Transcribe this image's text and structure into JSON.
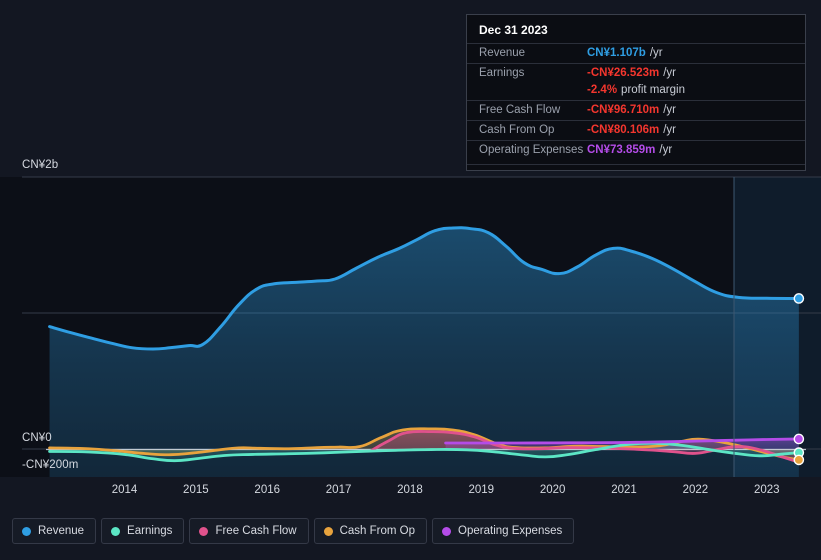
{
  "chart_data": {
    "type": "area",
    "title": "",
    "xlabel": "",
    "ylabel": "",
    "currency": "CN¥",
    "grid": true,
    "legend_position": "bottom",
    "y_ticks": [
      "CN¥2b",
      "CN¥0",
      "-CN¥200m"
    ],
    "ylim": [
      -200000000,
      2000000000
    ],
    "x_ticks": [
      "2014",
      "2015",
      "2016",
      "2017",
      "2018",
      "2019",
      "2020",
      "2021",
      "2022",
      "2023"
    ],
    "xlim": [
      "2013.4",
      "2024.1"
    ],
    "series": [
      {
        "name": "Revenue",
        "color": "#2f9ee3",
        "values": [
          {
            "x": 2013.45,
            "y": 900
          },
          {
            "x": 2013.75,
            "y": 855
          },
          {
            "x": 2014.0,
            "y": 820
          },
          {
            "x": 2014.3,
            "y": 780
          },
          {
            "x": 2014.6,
            "y": 745
          },
          {
            "x": 2014.9,
            "y": 735
          },
          {
            "x": 2015.15,
            "y": 745
          },
          {
            "x": 2015.4,
            "y": 760
          },
          {
            "x": 2015.6,
            "y": 770
          },
          {
            "x": 2015.85,
            "y": 900
          },
          {
            "x": 2016.1,
            "y": 1060
          },
          {
            "x": 2016.35,
            "y": 1175
          },
          {
            "x": 2016.6,
            "y": 1215
          },
          {
            "x": 2016.9,
            "y": 1225
          },
          {
            "x": 2017.2,
            "y": 1235
          },
          {
            "x": 2017.45,
            "y": 1250
          },
          {
            "x": 2017.75,
            "y": 1330
          },
          {
            "x": 2018.05,
            "y": 1410
          },
          {
            "x": 2018.35,
            "y": 1475
          },
          {
            "x": 2018.6,
            "y": 1540
          },
          {
            "x": 2018.85,
            "y": 1605
          },
          {
            "x": 2019.1,
            "y": 1625
          },
          {
            "x": 2019.35,
            "y": 1620
          },
          {
            "x": 2019.6,
            "y": 1590
          },
          {
            "x": 2019.85,
            "y": 1490
          },
          {
            "x": 2020.1,
            "y": 1370
          },
          {
            "x": 2020.35,
            "y": 1320
          },
          {
            "x": 2020.6,
            "y": 1290
          },
          {
            "x": 2020.85,
            "y": 1340
          },
          {
            "x": 2021.1,
            "y": 1425
          },
          {
            "x": 2021.35,
            "y": 1475
          },
          {
            "x": 2021.6,
            "y": 1455
          },
          {
            "x": 2021.9,
            "y": 1400
          },
          {
            "x": 2022.2,
            "y": 1320
          },
          {
            "x": 2022.5,
            "y": 1230
          },
          {
            "x": 2022.8,
            "y": 1150
          },
          {
            "x": 2023.1,
            "y": 1115
          },
          {
            "x": 2023.5,
            "y": 1108
          },
          {
            "x": 2023.95,
            "y": 1107
          }
        ]
      },
      {
        "name": "Earnings",
        "color": "#5ce6c5",
        "values": [
          {
            "x": 2013.45,
            "y": -18
          },
          {
            "x": 2014.0,
            "y": -22
          },
          {
            "x": 2014.5,
            "y": -40
          },
          {
            "x": 2014.9,
            "y": -72
          },
          {
            "x": 2015.2,
            "y": -86
          },
          {
            "x": 2015.5,
            "y": -72
          },
          {
            "x": 2015.9,
            "y": -48
          },
          {
            "x": 2016.3,
            "y": -40
          },
          {
            "x": 2016.8,
            "y": -35
          },
          {
            "x": 2017.3,
            "y": -28
          },
          {
            "x": 2017.8,
            "y": -18
          },
          {
            "x": 2018.3,
            "y": -10
          },
          {
            "x": 2018.8,
            "y": -4
          },
          {
            "x": 2019.3,
            "y": -6
          },
          {
            "x": 2019.7,
            "y": -22
          },
          {
            "x": 2020.1,
            "y": -45
          },
          {
            "x": 2020.4,
            "y": -58
          },
          {
            "x": 2020.7,
            "y": -42
          },
          {
            "x": 2021.1,
            "y": -5
          },
          {
            "x": 2021.5,
            "y": 30
          },
          {
            "x": 2021.8,
            "y": 42
          },
          {
            "x": 2022.1,
            "y": 38
          },
          {
            "x": 2022.4,
            "y": 20
          },
          {
            "x": 2022.7,
            "y": -5
          },
          {
            "x": 2023.0,
            "y": -28
          },
          {
            "x": 2023.4,
            "y": -50
          },
          {
            "x": 2023.7,
            "y": -38
          },
          {
            "x": 2023.95,
            "y": -26.523
          }
        ]
      },
      {
        "name": "Free Cash Flow",
        "color": "#e0528c",
        "values": [
          {
            "x": 2017.95,
            "y": -14
          },
          {
            "x": 2018.2,
            "y": 60
          },
          {
            "x": 2018.45,
            "y": 120
          },
          {
            "x": 2018.8,
            "y": 128
          },
          {
            "x": 2019.1,
            "y": 120
          },
          {
            "x": 2019.4,
            "y": 90
          },
          {
            "x": 2019.7,
            "y": 30
          },
          {
            "x": 2019.95,
            "y": 5
          },
          {
            "x": 2020.3,
            "y": 2
          },
          {
            "x": 2020.7,
            "y": 10
          },
          {
            "x": 2021.1,
            "y": 8
          },
          {
            "x": 2021.5,
            "y": 2
          },
          {
            "x": 2021.9,
            "y": -8
          },
          {
            "x": 2022.2,
            "y": -20
          },
          {
            "x": 2022.5,
            "y": -32
          },
          {
            "x": 2022.8,
            "y": -5
          },
          {
            "x": 2023.1,
            "y": 18
          },
          {
            "x": 2023.4,
            "y": -5
          },
          {
            "x": 2023.7,
            "y": -55
          },
          {
            "x": 2023.95,
            "y": -96.71
          }
        ]
      },
      {
        "name": "Cash From Op",
        "color": "#e8a33d",
        "values": [
          {
            "x": 2013.45,
            "y": 8
          },
          {
            "x": 2014.0,
            "y": 2
          },
          {
            "x": 2014.4,
            "y": -14
          },
          {
            "x": 2014.8,
            "y": -34
          },
          {
            "x": 2015.15,
            "y": -42
          },
          {
            "x": 2015.45,
            "y": -30
          },
          {
            "x": 2015.8,
            "y": -8
          },
          {
            "x": 2016.1,
            "y": 8
          },
          {
            "x": 2016.4,
            "y": 5
          },
          {
            "x": 2016.8,
            "y": 2
          },
          {
            "x": 2017.2,
            "y": 10
          },
          {
            "x": 2017.5,
            "y": 14
          },
          {
            "x": 2017.8,
            "y": 18
          },
          {
            "x": 2018.1,
            "y": 85
          },
          {
            "x": 2018.4,
            "y": 140
          },
          {
            "x": 2018.8,
            "y": 148
          },
          {
            "x": 2019.1,
            "y": 140
          },
          {
            "x": 2019.4,
            "y": 105
          },
          {
            "x": 2019.75,
            "y": 32
          },
          {
            "x": 2020.0,
            "y": 10
          },
          {
            "x": 2020.4,
            "y": 8
          },
          {
            "x": 2020.8,
            "y": 20
          },
          {
            "x": 2021.2,
            "y": 18
          },
          {
            "x": 2021.6,
            "y": 14
          },
          {
            "x": 2022.0,
            "y": 24
          },
          {
            "x": 2022.3,
            "y": 55
          },
          {
            "x": 2022.55,
            "y": 72
          },
          {
            "x": 2022.9,
            "y": 48
          },
          {
            "x": 2023.2,
            "y": 12
          },
          {
            "x": 2023.5,
            "y": -30
          },
          {
            "x": 2023.75,
            "y": -62
          },
          {
            "x": 2023.95,
            "y": -80.106
          }
        ]
      },
      {
        "name": "Operating Expenses",
        "color": "#b44ce8",
        "values": [
          {
            "x": 2019.0,
            "y": 44
          },
          {
            "x": 2019.5,
            "y": 44
          },
          {
            "x": 2020.0,
            "y": 44
          },
          {
            "x": 2020.5,
            "y": 45
          },
          {
            "x": 2021.0,
            "y": 46
          },
          {
            "x": 2021.5,
            "y": 48
          },
          {
            "x": 2022.0,
            "y": 52
          },
          {
            "x": 2022.5,
            "y": 58
          },
          {
            "x": 2023.0,
            "y": 64
          },
          {
            "x": 2023.5,
            "y": 70
          },
          {
            "x": 2023.95,
            "y": 73.859
          }
        ]
      }
    ]
  },
  "tooltip": {
    "title": "Dec 31 2023",
    "rows": [
      {
        "label": "Revenue",
        "value": "CN¥1.107b",
        "suffix": "/yr",
        "color": "#2f9ee3"
      },
      {
        "label": "Earnings",
        "value": "-CN¥26.523m",
        "suffix": "/yr",
        "color": "#f4362e"
      },
      {
        "label": "",
        "value": "-2.4%",
        "suffix": "profit margin",
        "color": "#f4362e"
      },
      {
        "label": "Free Cash Flow",
        "value": "-CN¥96.710m",
        "suffix": "/yr",
        "color": "#f4362e"
      },
      {
        "label": "Cash From Op",
        "value": "-CN¥80.106m",
        "suffix": "/yr",
        "color": "#f4362e"
      },
      {
        "label": "Operating Expenses",
        "value": "CN¥73.859m",
        "suffix": "/yr",
        "color": "#b44ce8"
      }
    ]
  },
  "legend": {
    "items": [
      {
        "label": "Revenue",
        "color": "#2f9ee3"
      },
      {
        "label": "Earnings",
        "color": "#5ce6c5"
      },
      {
        "label": "Free Cash Flow",
        "color": "#e0528c"
      },
      {
        "label": "Cash From Op",
        "color": "#e8a33d"
      },
      {
        "label": "Operating Expenses",
        "color": "#b44ce8"
      }
    ]
  },
  "axes": {
    "y": [
      {
        "label": "CN¥2b",
        "value": 2000
      },
      {
        "label": "CN¥0",
        "value": 0
      },
      {
        "label": "-CN¥200m",
        "value": -200
      }
    ],
    "x": [
      "2014",
      "2015",
      "2016",
      "2017",
      "2018",
      "2019",
      "2020",
      "2021",
      "2022",
      "2023"
    ]
  },
  "theme": {
    "background": "#131722",
    "plot_background": "#0c0f17",
    "grid": "#2c3340",
    "zero_line": "#cfd4dd",
    "highlight_band": "#14304a"
  }
}
